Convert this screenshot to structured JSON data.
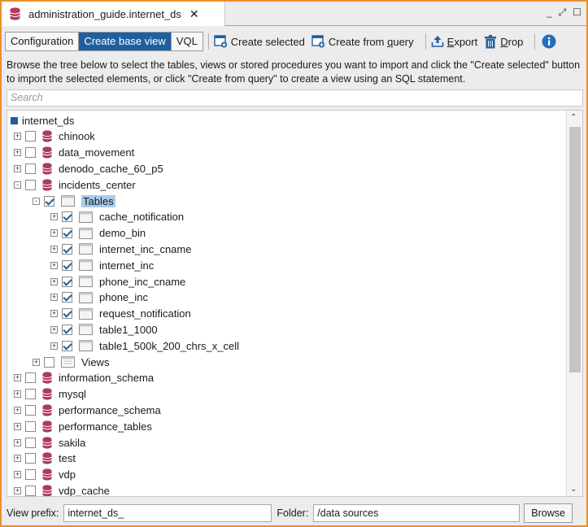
{
  "tab": {
    "title": "administration_guide.internet_ds",
    "close": "✕"
  },
  "window_controls": {
    "minimize": "_",
    "maximize": "⤢",
    "restore": "☐"
  },
  "toolbar": {
    "configuration": "Configuration",
    "create_base_view": "Create base view",
    "vql": "VQL",
    "create_selected": "Create selected",
    "create_from_query_pre": "Create from ",
    "create_from_query_u": "q",
    "create_from_query_post": "uery",
    "export_u": "E",
    "export_rest": "xport",
    "drop_u": "D",
    "drop_rest": "rop"
  },
  "description": "Browse the tree below to select the tables, views or stored procedures you want to import and click the \"Create selected\" button to import the selected elements, or click \"Create from query\" to create a view using an SQL statement.",
  "search": {
    "placeholder": "Search"
  },
  "tree": {
    "root": "internet_ds",
    "databases_top": [
      "chinook",
      "data_movement",
      "denodo_cache_60_p5",
      "incidents_center"
    ],
    "tables_node": "Tables",
    "tables": [
      "cache_notification",
      "demo_bin",
      "internet_inc_cname",
      "internet_inc",
      "phone_inc_cname",
      "phone_inc",
      "request_notification",
      "table1_1000",
      "table1_500k_200_chrs_x_cell"
    ],
    "views_node": "Views",
    "databases_bottom": [
      "information_schema",
      "mysql",
      "performance_schema",
      "performance_tables",
      "sakila",
      "test",
      "vdp",
      "vdp_cache"
    ]
  },
  "footer": {
    "view_prefix_label": "View prefix:",
    "view_prefix_value": "internet_ds_",
    "folder_label": "Folder:",
    "folder_value": "/data sources",
    "browse": "Browse"
  },
  "colors": {
    "accent": "#e8902c",
    "active_tab": "#1f5fa0",
    "db_icon": "#b03a5a",
    "selection": "#a8cbe8"
  }
}
